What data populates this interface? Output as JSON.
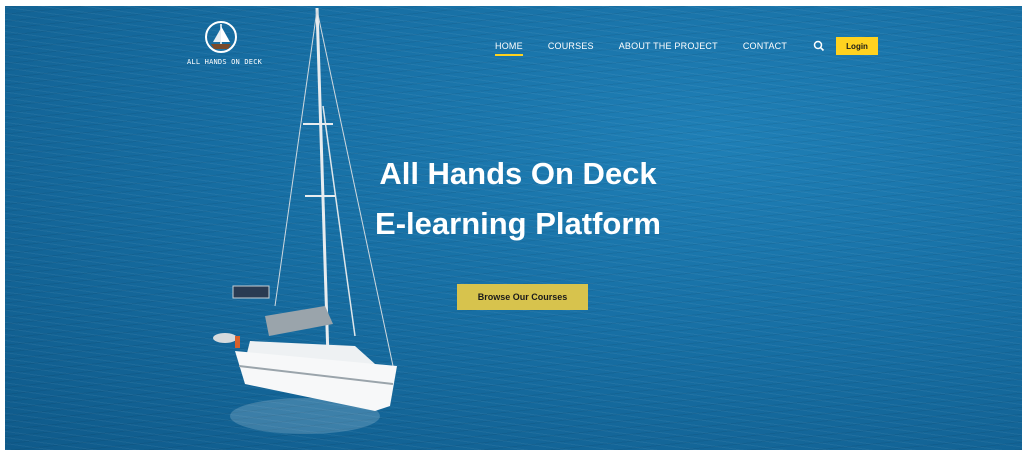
{
  "brand": {
    "logo_text": "ALL HANDS ON DECK",
    "logo_icon": "sailboat-emblem-icon"
  },
  "nav": {
    "items": [
      {
        "label": "HOME",
        "active": true
      },
      {
        "label": "COURSES"
      },
      {
        "label": "ABOUT THE PROJECT"
      },
      {
        "label": "CONTACT"
      }
    ],
    "search_icon": "search-icon",
    "login_label": "Login"
  },
  "hero": {
    "title_line1": "All Hands On Deck",
    "title_line2": "E-learning Platform",
    "cta_label": "Browse Our Courses"
  },
  "colors": {
    "accent": "#ffd21f",
    "cta": "#d7c34d",
    "sea": "#176fa4",
    "text": "#ffffff"
  }
}
